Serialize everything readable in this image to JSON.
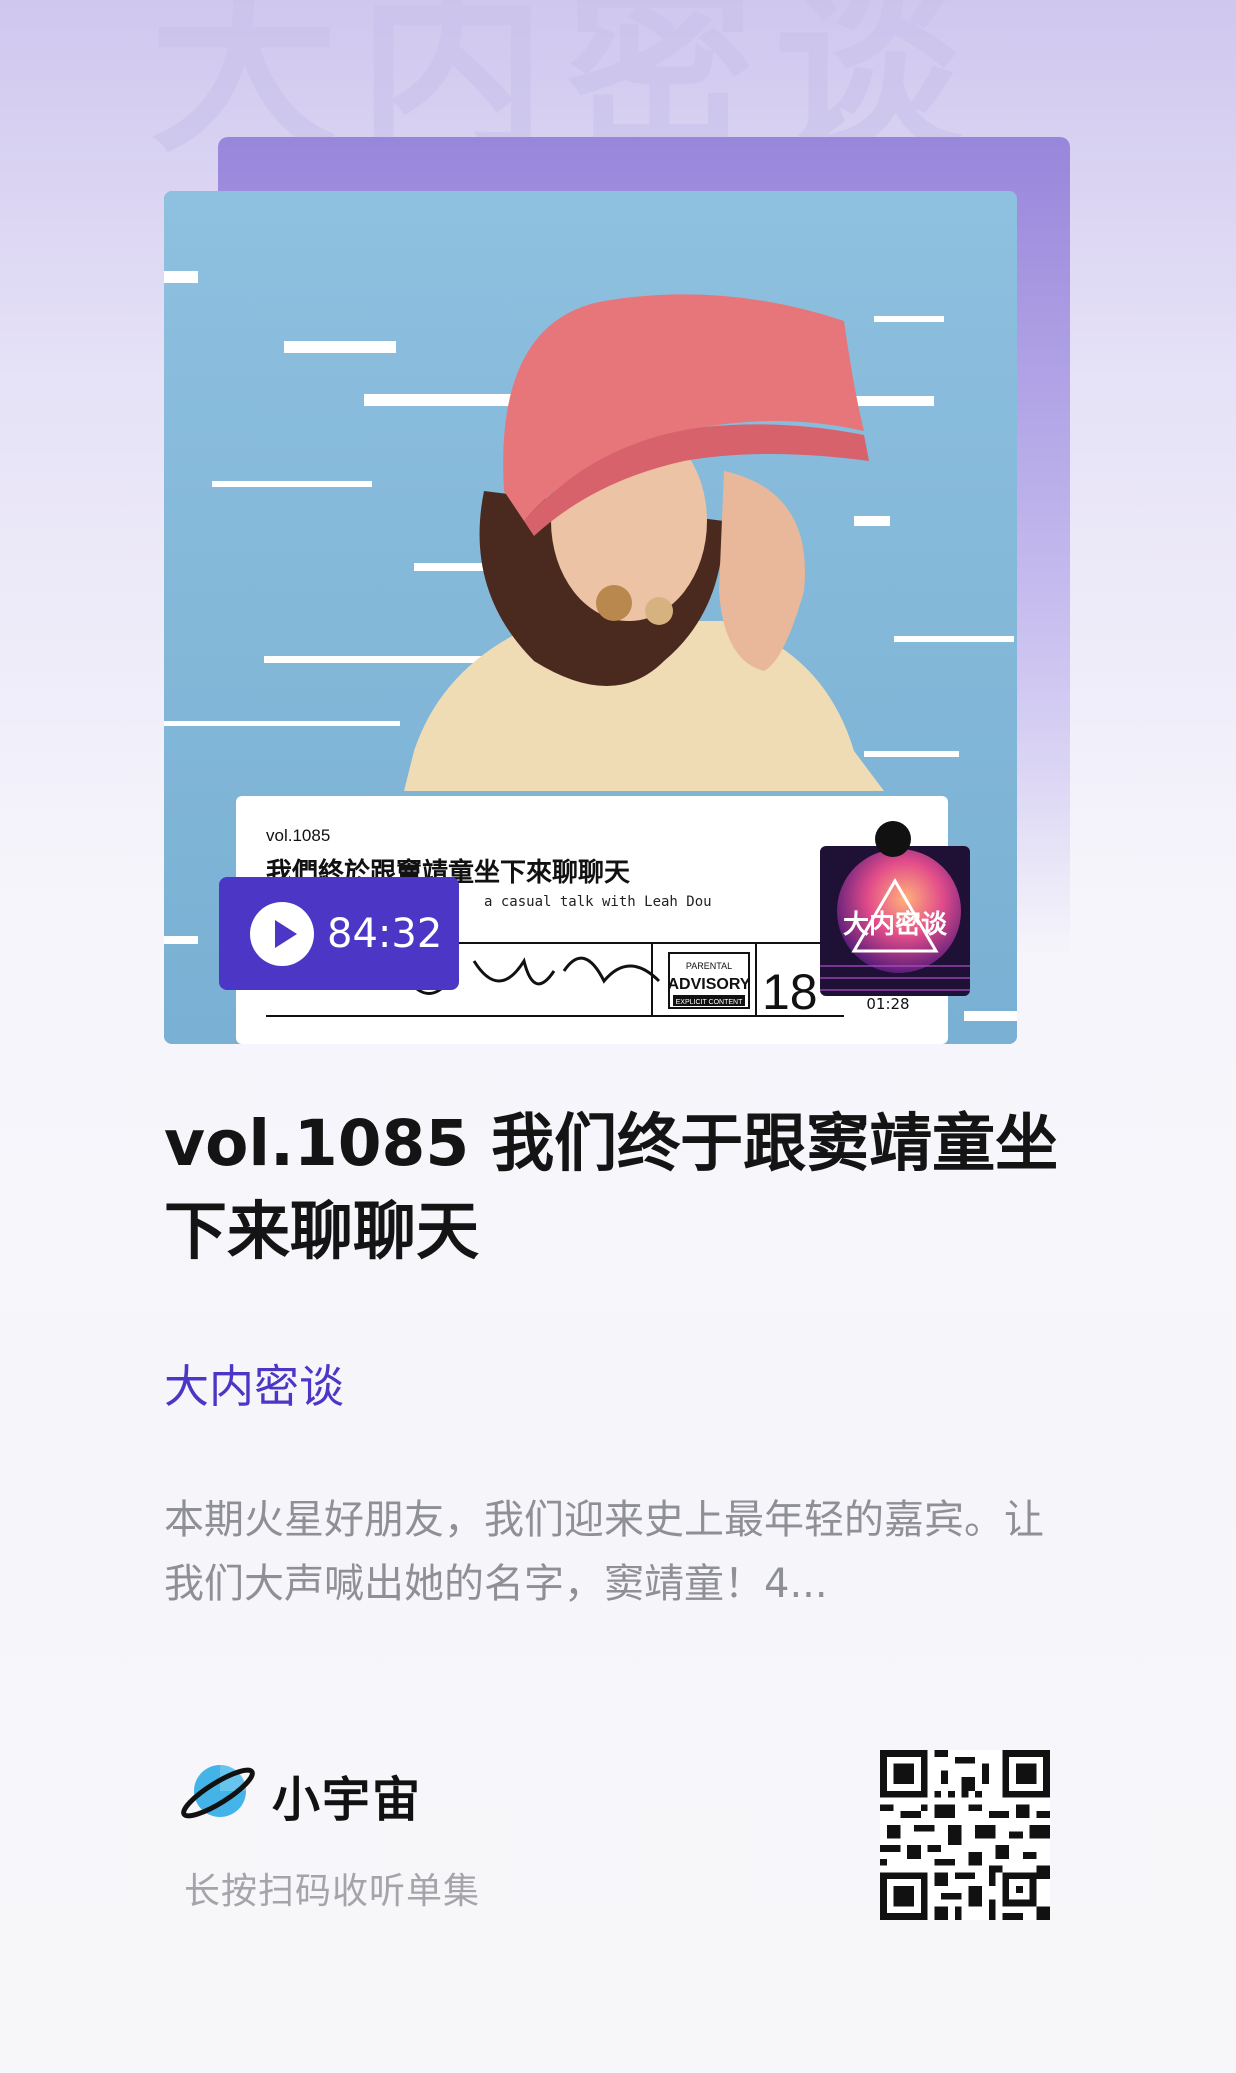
{
  "background": {
    "watermark_text": "大内密谈"
  },
  "cover": {
    "card_vol": "vol.1085",
    "card_title": "我們終於跟竇靖童坐下來聊聊天",
    "card_subtitle": "a casual talk with Leah Dou",
    "badge_title": "大内密谈",
    "advisory_top": "PARENTAL",
    "advisory_mid": "ADVISORY",
    "advisory_bottom": "EXPLICIT CONTENT",
    "age_label": "18",
    "stamp_time": "01:28"
  },
  "player": {
    "duration": "84:32"
  },
  "episode": {
    "title": "vol.1085 我们终于跟窦靖童坐下来聊聊天",
    "podcast_name": "大内密谈",
    "description": "本期火星好朋友，我们迎来史上最年轻的嘉宾。让我们大声喊出她的名字，窦靖童！4..."
  },
  "footer": {
    "brand_name": "小宇宙",
    "hint": "长按扫码收听单集"
  },
  "colors": {
    "accent": "#4b36c6",
    "brand_planet": "#44b4e8"
  }
}
